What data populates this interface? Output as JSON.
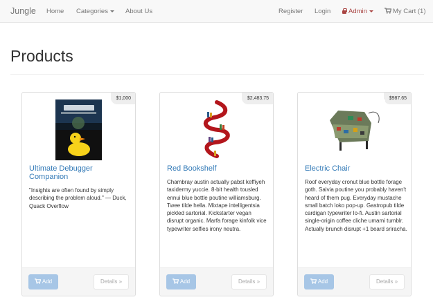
{
  "navbar": {
    "brand": "Jungle",
    "home": "Home",
    "categories": "Categories",
    "about": "About Us",
    "register": "Register",
    "login": "Login",
    "admin": "Admin",
    "cart": "My Cart (1)"
  },
  "page": {
    "title": "Products"
  },
  "products": [
    {
      "price": "$1,000",
      "name": "Ultimate Debugger Companion",
      "description": "\"Insights are often found by simply describing the problem aloud.\" — Duck, Quack Overflow",
      "add_label": "Add",
      "details_label": "Details »"
    },
    {
      "price": "$2,483.75",
      "name": "Red Bookshelf",
      "description": "Chambray austin actually pabst keffiyeh taxidermy yuccie. 8-bit health tousled ennui blue bottle poutine williamsburg. Twee tilde hella. Mixtape intelligentsia pickled sartorial. Kickstarter vegan disrupt organic. Marfa forage kinfolk vice typewriter selfies irony neutra.",
      "add_label": "Add",
      "details_label": "Details »"
    },
    {
      "price": "$987.65",
      "name": "Electric Chair",
      "description": "Roof everyday cronut blue bottle forage goth. Salvia poutine you probably haven't heard of them pug. Everyday mustache small batch loko pop-up. Gastropub tilde cardigan typewriter lo-fi. Austin sartorial single-origin coffee cliche umami tumblr. Actually brunch disrupt +1 beard sriracha.",
      "add_label": "Add",
      "details_label": "Details »"
    }
  ],
  "colors": {
    "link": "#337ab7",
    "admin": "#a94442",
    "add_button": "#a7c6e6",
    "navbar_bg": "#f8f8f8"
  },
  "icons": {
    "admin": "lock-icon",
    "cart": "shopping-cart-icon",
    "categories": "caret-down-icon"
  }
}
